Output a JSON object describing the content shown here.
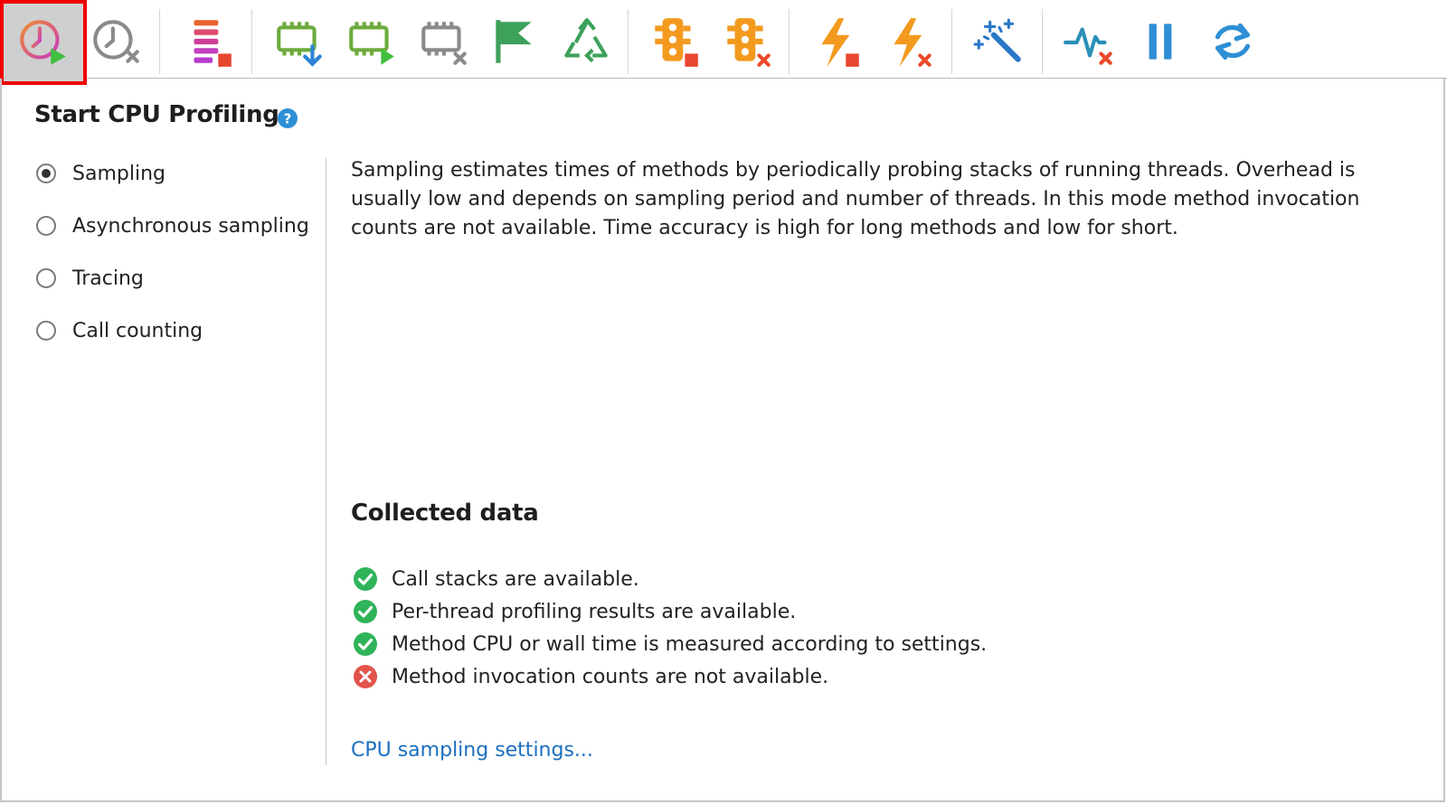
{
  "toolbar": {
    "buttons": [
      {
        "name": "start-cpu-profiling-button",
        "icon": "clock-start-icon",
        "active": true
      },
      {
        "name": "stop-cpu-profiling-button",
        "icon": "clock-stop-icon"
      },
      {
        "name": "stop-stack-telemetry-button",
        "icon": "stack-stop-icon"
      },
      {
        "name": "capture-memory-snapshot-button",
        "icon": "memory-download-icon"
      },
      {
        "name": "start-allocation-recording-button",
        "icon": "memory-start-icon"
      },
      {
        "name": "stop-allocation-recording-button",
        "icon": "memory-stop-icon"
      },
      {
        "name": "mark-button",
        "icon": "flag-icon"
      },
      {
        "name": "force-gc-button",
        "icon": "recycle-icon"
      },
      {
        "name": "stop-monitor-profiling-button",
        "icon": "traffic-light-stop-icon"
      },
      {
        "name": "clear-monitor-profiling-button",
        "icon": "traffic-light-clear-icon"
      },
      {
        "name": "stop-exception-profiling-button",
        "icon": "lightning-stop-icon"
      },
      {
        "name": "clear-exception-profiling-button",
        "icon": "lightning-clear-icon"
      },
      {
        "name": "triggers-button",
        "icon": "magic-wand-icon"
      },
      {
        "name": "stop-telemetry-button",
        "icon": "pulse-stop-icon"
      },
      {
        "name": "pause-button",
        "icon": "pause-icon"
      },
      {
        "name": "refresh-button",
        "icon": "refresh-icon"
      }
    ]
  },
  "colors": {
    "accent_blue": "#2e8fd6",
    "link": "#1b6fc0",
    "check_green": "#2fb45a",
    "cross_red": "#e2534b",
    "highlight_red": "#f00000"
  },
  "heading": "Start CPU Profiling",
  "modes": [
    {
      "label": "Sampling",
      "selected": true
    },
    {
      "label": "Asynchronous sampling",
      "selected": false
    },
    {
      "label": "Tracing",
      "selected": false
    },
    {
      "label": "Call counting",
      "selected": false
    }
  ],
  "description": "Sampling estimates times of methods by periodically probing stacks of running threads. Overhead is usually low and depends on sampling period and number of threads. In this mode method invocation counts are not available. Time accuracy is high for long methods and low for short.",
  "collected": {
    "title": "Collected data",
    "items": [
      {
        "text": "Call stacks are available.",
        "ok": true
      },
      {
        "text": "Per-thread profiling results are available.",
        "ok": true
      },
      {
        "text": "Method CPU or wall time is measured according to settings.",
        "ok": true
      },
      {
        "text": "Method invocation counts are not available.",
        "ok": false
      }
    ]
  },
  "settings_link": "CPU sampling settings..."
}
